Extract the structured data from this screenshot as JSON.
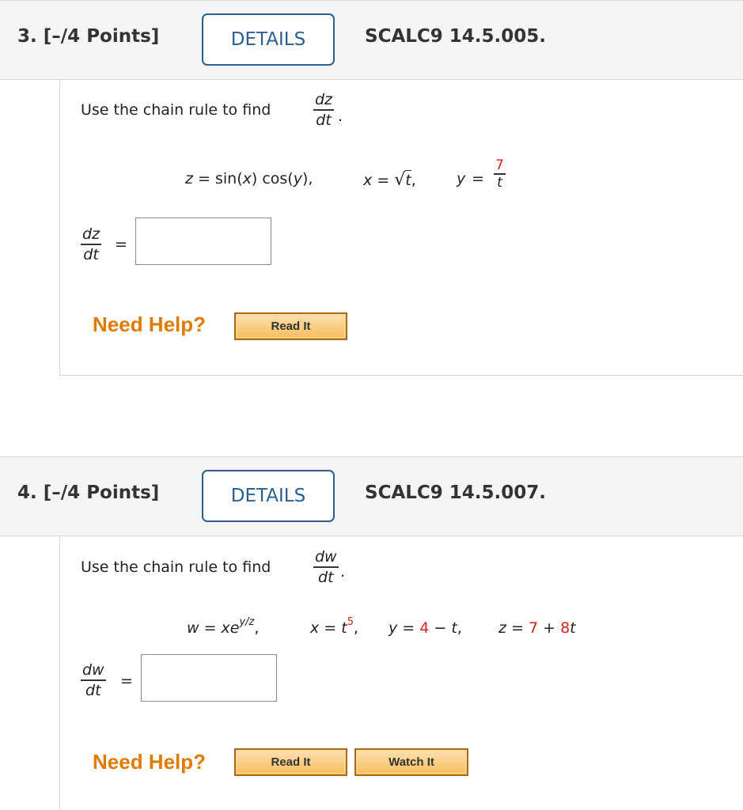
{
  "questions": [
    {
      "number": "3.",
      "points": "[–/4 Points]",
      "details_label": "DETAILS",
      "code": "SCALC9 14.5.005.",
      "prompt": "Use the chain rule to find",
      "derivative": {
        "num": "dz",
        "den": "dt"
      },
      "equation": {
        "z_def": "z = sin(x) cos(y),",
        "x_def": "x =",
        "x_radicand": "t",
        "y_def": "y =",
        "y_num": "7",
        "y_den": "t"
      },
      "answer_label": {
        "num": "dz",
        "den": "dt",
        "eq": "="
      },
      "answer_value": "",
      "need_help": "Need Help?",
      "help_buttons": [
        "Read It"
      ]
    },
    {
      "number": "4.",
      "points": "[–/4 Points]",
      "details_label": "DETAILS",
      "code": "SCALC9 14.5.007.",
      "prompt": "Use the chain rule to find",
      "derivative": {
        "num": "dw",
        "den": "dt"
      },
      "equation": {
        "w_def": "w = xe",
        "w_exp": "y/z",
        "x_def": "x = t",
        "x_exp": "5",
        "y_def": "y =",
        "y_const": "4",
        "y_rest": "− t,",
        "z_def": "z =",
        "z_const": "7",
        "z_rest": "+ 8t"
      },
      "answer_label": {
        "num": "dw",
        "den": "dt",
        "eq": "="
      },
      "answer_value": "",
      "need_help": "Need Help?",
      "help_buttons": [
        "Read It",
        "Watch It"
      ]
    }
  ],
  "colors": {
    "accent": "#2a5f8f",
    "highlight": "#d0241c",
    "help": "#e07b00",
    "header_bg": "#f5f5f5"
  }
}
